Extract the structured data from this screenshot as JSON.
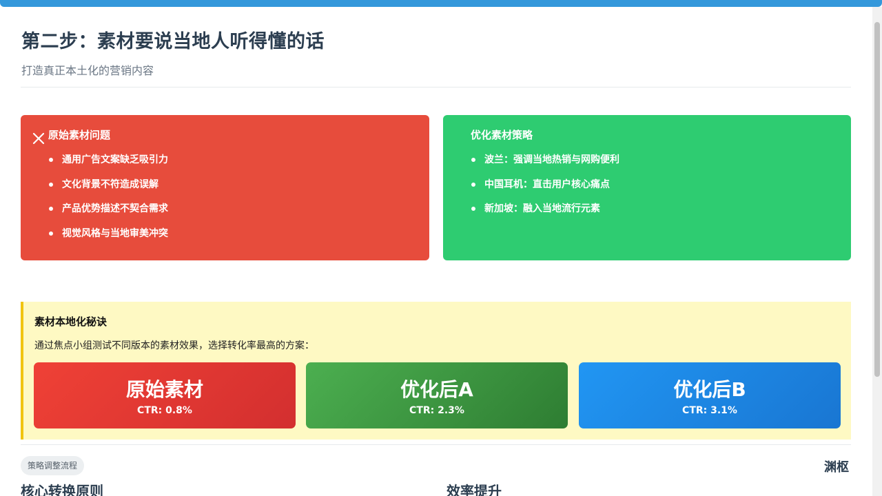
{
  "header": {
    "title": "第二步：素材要说当地人听得懂的话",
    "subtitle": "打造真正本土化的营销内容"
  },
  "problems_card": {
    "icon": "close-icon",
    "title": "原始素材问题",
    "items": [
      "通用广告文案缺乏吸引力",
      "文化背景不符造成误解",
      "产品优势描述不契合需求",
      "视觉风格与当地审美冲突"
    ]
  },
  "strategy_card": {
    "title": "优化素材策略",
    "items": [
      "波兰：强调当地热销与网购便利",
      "中国耳机：直击用户核心痛点",
      "新加坡：融入当地流行元素"
    ]
  },
  "tips": {
    "title": "素材本地化秘诀",
    "description": "通过焦点小组测试不同版本的素材效果，选择转化率最高的方案：",
    "variants": [
      {
        "name": "原始素材",
        "ctr": "CTR: 0.8%"
      },
      {
        "name": "优化后A",
        "ctr": "CTR: 2.3%"
      },
      {
        "name": "优化后B",
        "ctr": "CTR: 3.1%"
      }
    ]
  },
  "footer": {
    "tag": "策略调整流程",
    "brand": "渊枢",
    "section_left": "核心转换原则",
    "section_right": "效率提升"
  },
  "colors": {
    "accent": "#3498db",
    "problem": "#e74c3c",
    "strategy": "#2ecc71",
    "tips_bg": "#fef9c3",
    "tips_border": "#f1c40f"
  }
}
